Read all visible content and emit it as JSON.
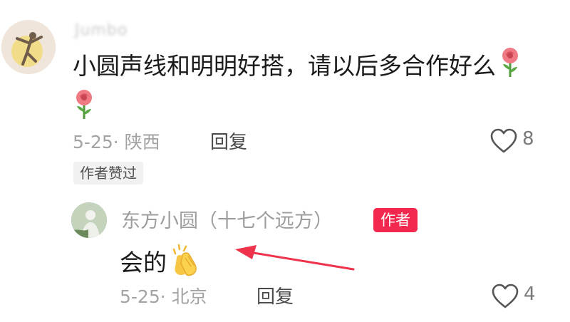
{
  "comment": {
    "username": "Jumbo",
    "text": "小圆声线和明明好搭，请以后多合作好么",
    "date_location": "5-25· 陕西",
    "reply_label": "回复",
    "like_count": "8",
    "liked_tag": "作者赞过",
    "emoji_icon": "rose-icon"
  },
  "reply": {
    "username": "东方小圆（十七个远方）",
    "badge": "作者",
    "text": "会的",
    "emoji_icon": "clapping-hands-icon",
    "date_location": "5-25· 北京",
    "reply_label": "回复",
    "like_count": "4"
  },
  "colors": {
    "badge_red": "#f3284f",
    "annotation_arrow": "#f0334d"
  }
}
